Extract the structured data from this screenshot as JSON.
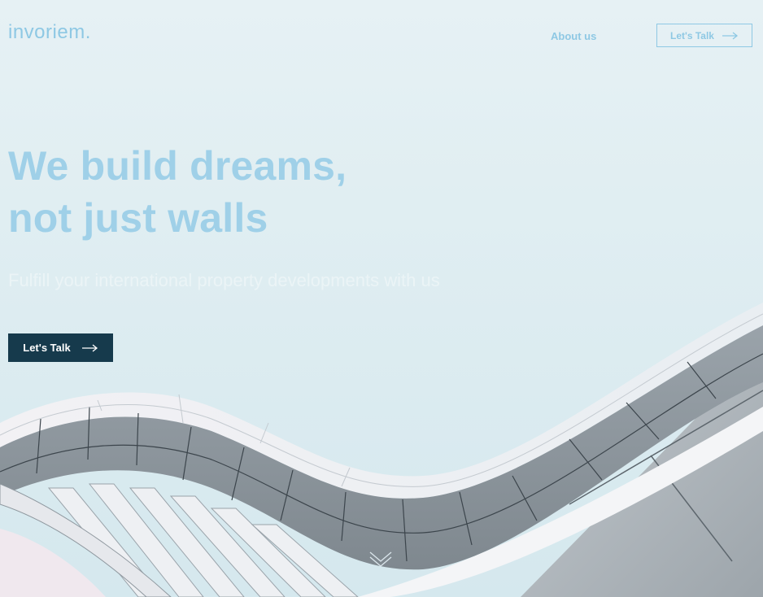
{
  "header": {
    "logo": "invoriem.",
    "nav": {
      "about": "About us"
    },
    "cta_label": "Let's Talk"
  },
  "hero": {
    "title_line1": "We build dreams,",
    "title_line2": "not just walls",
    "subtitle": "Fulfill your international property developments with us",
    "cta_label": "Let's Talk"
  },
  "icons": {
    "header_cta_icon": "arrow-right-icon",
    "hero_cta_icon": "arrow-right-icon",
    "scroll_icon": "chevron-down-icon"
  },
  "colors": {
    "accent": "#8ec8e4",
    "primary_button": "#163a4c",
    "background": "#e2eff3"
  }
}
